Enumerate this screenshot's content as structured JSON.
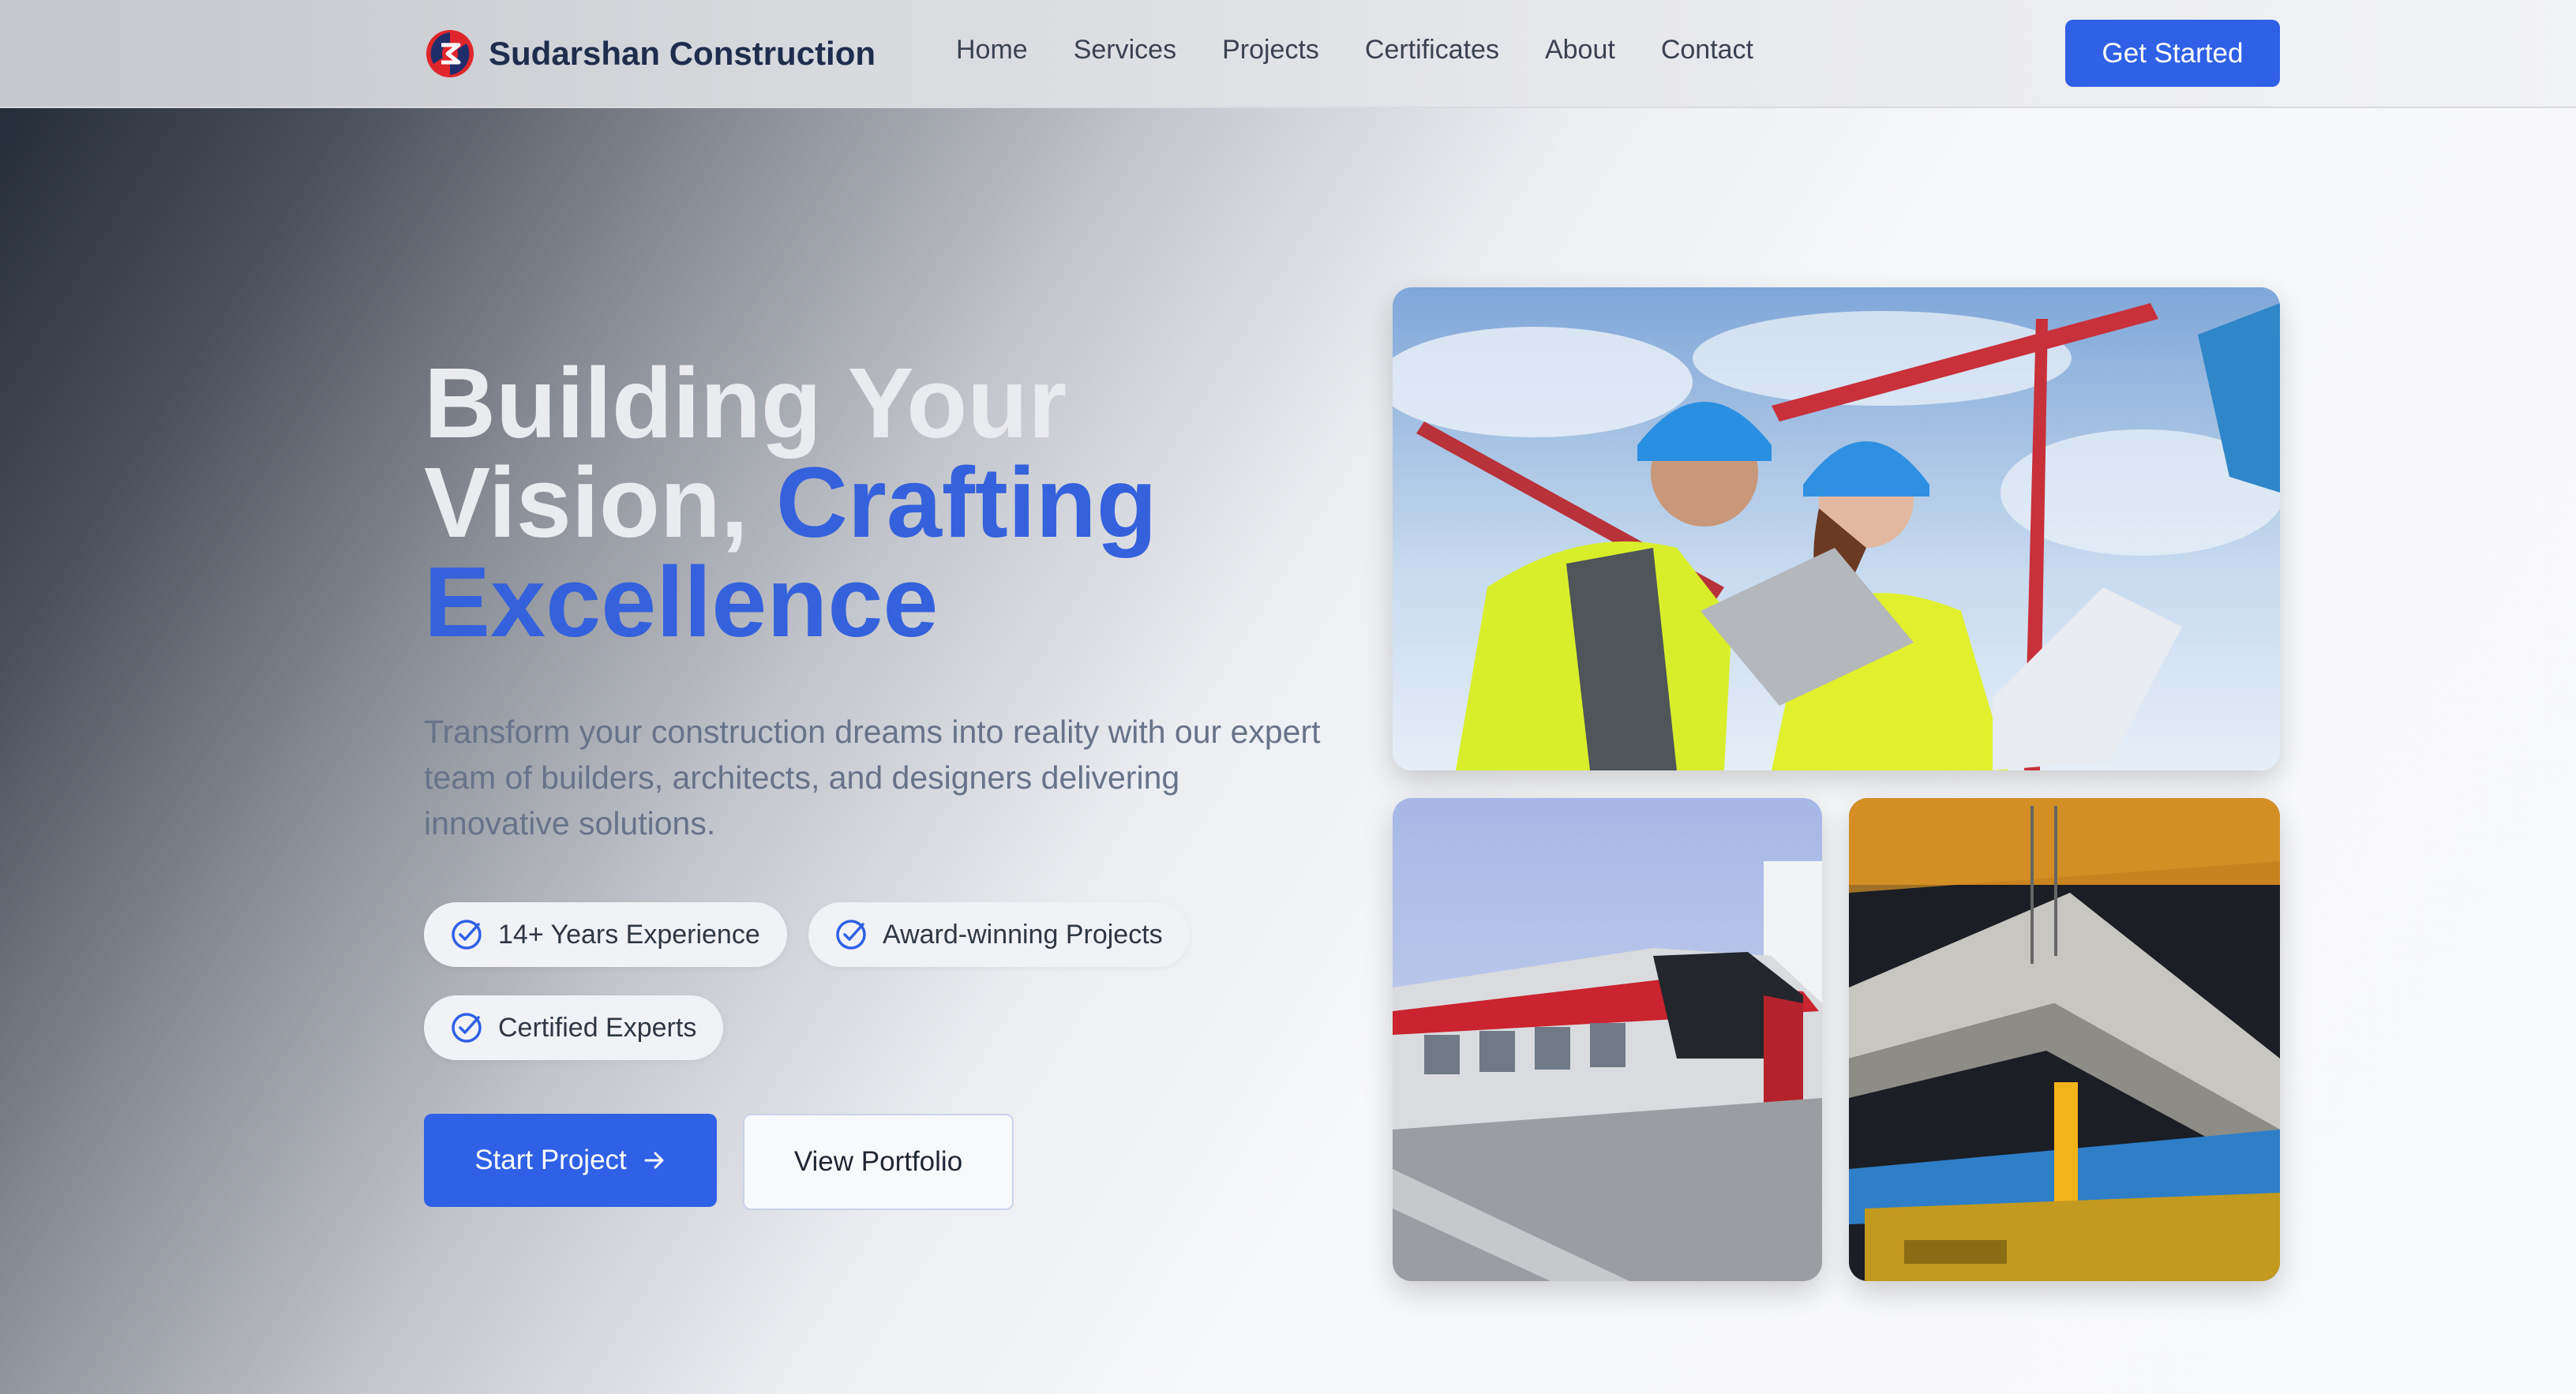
{
  "header": {
    "brand_name": "Sudarshan Construction",
    "logo_icon": "sudarshan-chakra-logo",
    "nav": [
      "Home",
      "Services",
      "Projects",
      "Certificates",
      "About",
      "Contact"
    ],
    "cta_label": "Get Started"
  },
  "hero": {
    "headline_line1": "Building Your",
    "headline_line2_plain": "Vision, ",
    "headline_line2_accent": "Crafting",
    "headline_line3_accent": "Excellence",
    "subtitle": "Transform your construction dreams into reality with our expert team of builders, architects, and designers delivering innovative solutions.",
    "badges": [
      "14+ Years Experience",
      "Award-winning Projects",
      "Certified Experts"
    ],
    "badge_icon": "check-circle-icon",
    "primary_button": "Start Project",
    "primary_button_icon": "arrow-right-icon",
    "secondary_button": "View Portfolio"
  },
  "images": [
    {
      "name": "engineers-with-tablet-photo"
    },
    {
      "name": "metro-train-photo"
    },
    {
      "name": "bridge-girder-photo"
    }
  ],
  "colors": {
    "accent": "#2f60e6",
    "headline_accent": "#3561dc",
    "brand_text": "#1f2d4d",
    "logo_red": "#e0262c",
    "logo_navy": "#1f2d6b"
  }
}
